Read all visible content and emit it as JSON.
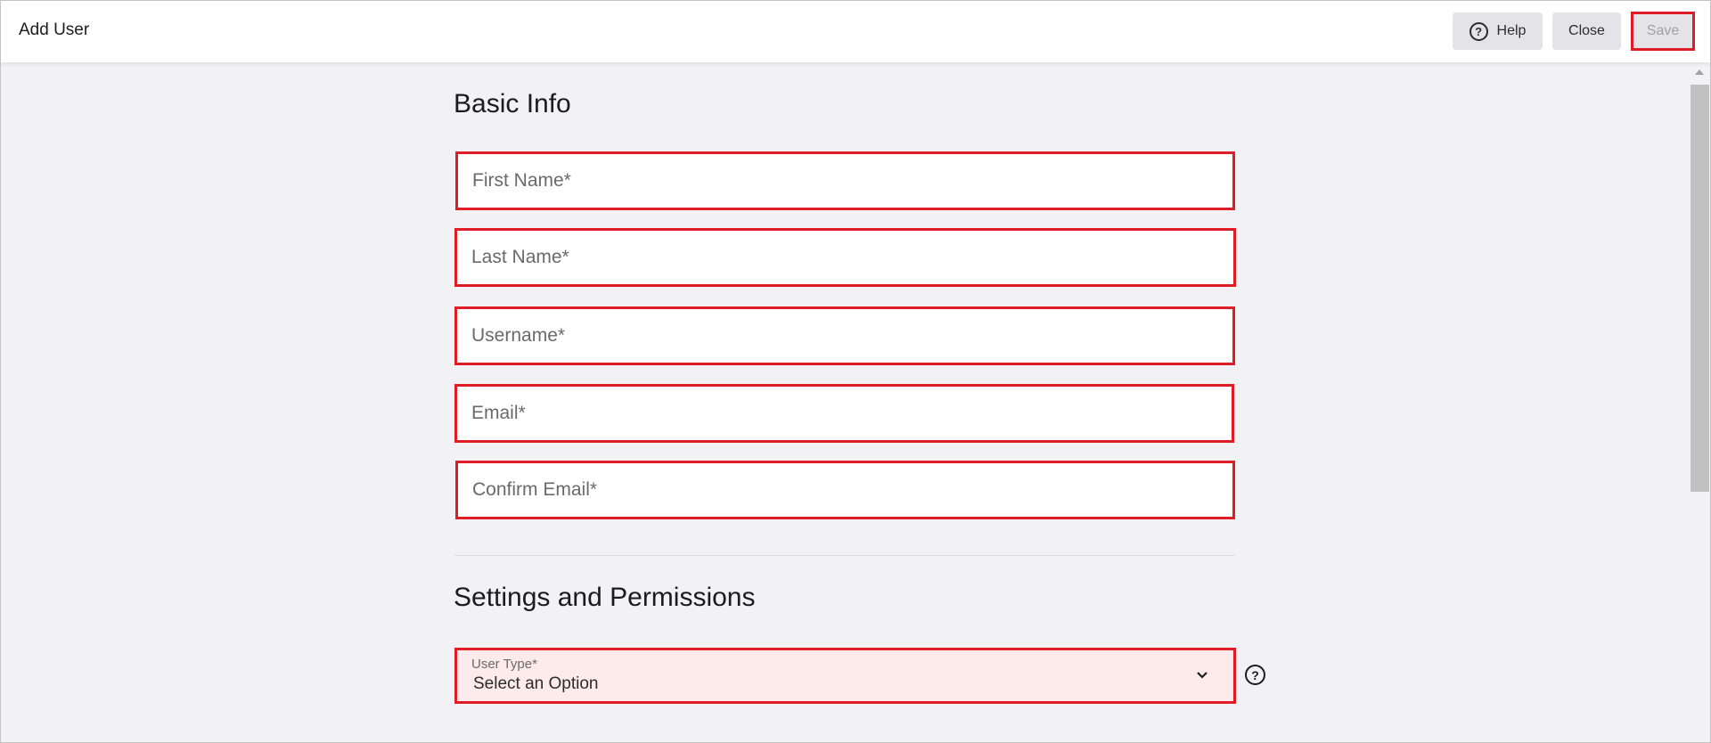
{
  "header": {
    "title": "Add User",
    "buttons": {
      "help": {
        "label": "Help",
        "icon": "question-circle-icon",
        "icon_glyph": "?"
      },
      "close": {
        "label": "Close"
      },
      "save": {
        "label": "Save",
        "state": "disabled"
      }
    }
  },
  "sections": {
    "basic_info": {
      "title": "Basic Info",
      "fields": [
        {
          "name": "first_name",
          "placeholder": "First Name*",
          "value": ""
        },
        {
          "name": "last_name",
          "placeholder": "Last Name*",
          "value": ""
        },
        {
          "name": "username",
          "placeholder": "Username*",
          "value": ""
        },
        {
          "name": "email",
          "placeholder": "Email*",
          "value": ""
        },
        {
          "name": "confirm_email",
          "placeholder": "Confirm Email*",
          "value": ""
        }
      ]
    },
    "settings": {
      "title": "Settings and Permissions",
      "user_type": {
        "label": "User Type*",
        "selected": "Select an Option",
        "help_glyph": "?"
      }
    }
  },
  "colors": {
    "highlight": "#e01c26",
    "error_fill": "#fdeaea",
    "background": "#f2f2f4",
    "button_bg": "#e4e4e8"
  }
}
